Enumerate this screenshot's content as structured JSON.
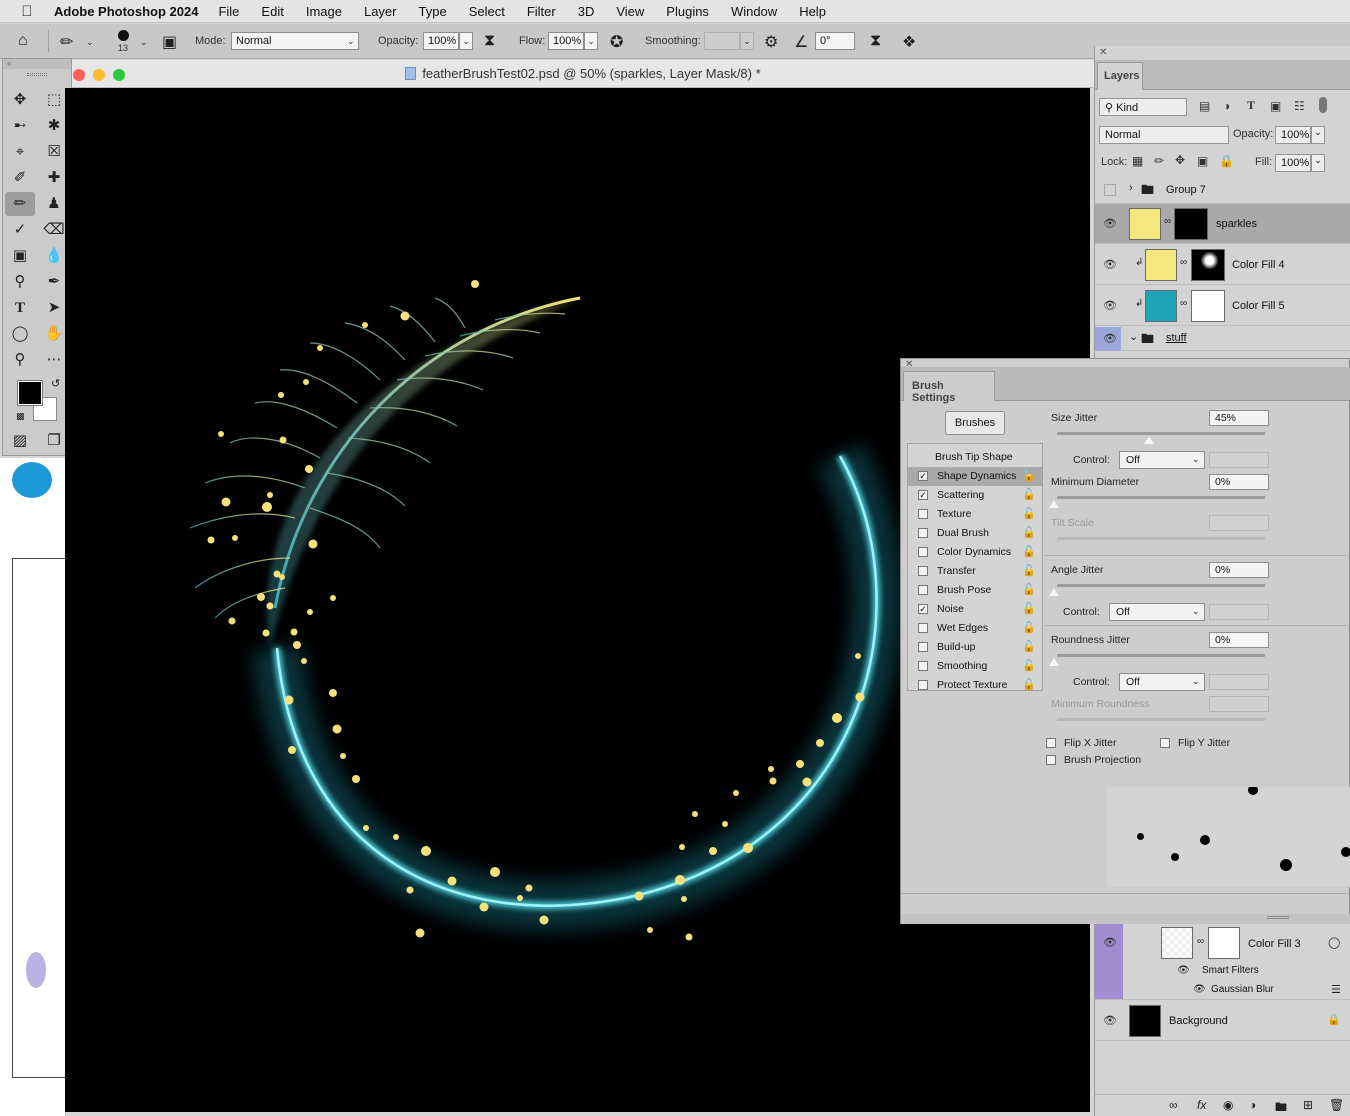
{
  "menubar": {
    "apple_icon": "apple-icon",
    "app_name": "Adobe Photoshop 2024",
    "items": [
      "File",
      "Edit",
      "Image",
      "Layer",
      "Type",
      "Select",
      "Filter",
      "3D",
      "View",
      "Plugins",
      "Window",
      "Help"
    ]
  },
  "options_bar": {
    "brush_size": "13",
    "mode_label": "Mode:",
    "mode_value": "Normal",
    "opacity_label": "Opacity:",
    "opacity_value": "100%",
    "flow_label": "Flow:",
    "flow_value": "100%",
    "smoothing_label": "Smoothing:",
    "smoothing_value": "",
    "angle_value": "0°"
  },
  "document": {
    "title": "featherBrushTest02.psd @ 50% (sparkles, Layer Mask/8) *"
  },
  "layers_panel": {
    "tab": "Layers",
    "kind_label": "Kind",
    "blend_mode": "Normal",
    "opacity_label": "Opacity:",
    "opacity_value": "100%",
    "lock_label": "Lock:",
    "fill_label": "Fill:",
    "fill_value": "100%",
    "layers": [
      {
        "name": "Group 7"
      },
      {
        "name": "sparkles"
      },
      {
        "name": "Color Fill 4"
      },
      {
        "name": "Color Fill 5"
      },
      {
        "name": "stuff"
      },
      {
        "name": "Color Fill 3"
      },
      {
        "name": "Smart Filters"
      },
      {
        "name": "Gaussian Blur"
      },
      {
        "name": "Background"
      }
    ],
    "colors": {
      "yellow": "#f5e77e",
      "teal": "#1fa4b8",
      "purple_tag": "#a08ed0",
      "blue_tag": "#9aa7d8"
    }
  },
  "brush_settings": {
    "tab": "Brush Settings",
    "brushes_button": "Brushes",
    "list": [
      {
        "label": "Brush Tip Shape",
        "checkbox": false,
        "checked": false
      },
      {
        "label": "Shape Dynamics",
        "checkbox": true,
        "checked": true
      },
      {
        "label": "Scattering",
        "checkbox": true,
        "checked": true
      },
      {
        "label": "Texture",
        "checkbox": true,
        "checked": false
      },
      {
        "label": "Dual Brush",
        "checkbox": true,
        "checked": false
      },
      {
        "label": "Color Dynamics",
        "checkbox": true,
        "checked": false
      },
      {
        "label": "Transfer",
        "checkbox": true,
        "checked": false
      },
      {
        "label": "Brush Pose",
        "checkbox": true,
        "checked": false
      },
      {
        "label": "Noise",
        "checkbox": true,
        "checked": true
      },
      {
        "label": "Wet Edges",
        "checkbox": true,
        "checked": false
      },
      {
        "label": "Build-up",
        "checkbox": true,
        "checked": false
      },
      {
        "label": "Smoothing",
        "checkbox": true,
        "checked": false
      },
      {
        "label": "Protect Texture",
        "checkbox": true,
        "checked": false
      }
    ],
    "size_jitter_label": "Size Jitter",
    "size_jitter_value": "45%",
    "control_label": "Control:",
    "control_value": "Off",
    "min_diameter_label": "Minimum Diameter",
    "min_diameter_value": "0%",
    "tilt_scale_label": "Tilt Scale",
    "angle_jitter_label": "Angle Jitter",
    "angle_jitter_value": "0%",
    "roundness_jitter_label": "Roundness Jitter",
    "roundness_jitter_value": "0%",
    "min_roundness_label": "Minimum Roundness",
    "flip_x_label": "Flip X Jitter",
    "flip_y_label": "Flip Y Jitter",
    "brush_projection_label": "Brush Projection"
  }
}
